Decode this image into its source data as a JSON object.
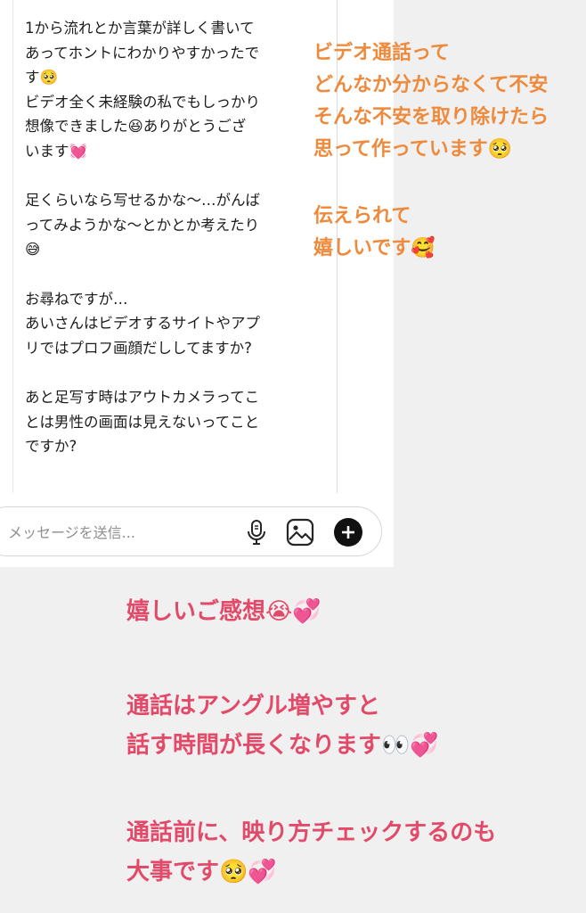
{
  "chat": {
    "message": "1から流れとか言葉が詳しく書いて\nあってホントにわかりやすかったで\nす🥺\nビデオ全く未経験の私でもしっかり\n想像できました😆ありがとうござ\nいます💓\n\n足くらいなら写せるかな〜…がんば\nってみようかな〜とかとか考えたり\n😅\n\nお尋ねですが…\nあいさんはビデオするサイトやアプ\nリではプロフ画顔だししてますか?\n\nあと足写す時はアウトカメラってこ\nとは男性の画面は見えないってこと\nですか?"
  },
  "composer": {
    "placeholder": "メッセージを送信...",
    "mic_icon": "microphone-icon",
    "image_icon": "image-icon",
    "add_icon": "add-icon"
  },
  "overlays": {
    "orange_1": "ビデオ通話って\nどんなか分からなくて不安\nそんな不安を取り除けたら\n思って作っています🥺",
    "orange_2": "伝えられて\n嬉しいです🥰",
    "red_1": "嬉しいご感想😭💞",
    "red_2": "通話はアングル増やすと\n話す時間が長くなります👀💞",
    "red_3": "通話前に、映り方チェックするのも\n大事です🥺💞"
  },
  "colors": {
    "orange": "#ee8a3c",
    "red": "#e24a6a",
    "background": "#f1f0f0"
  }
}
